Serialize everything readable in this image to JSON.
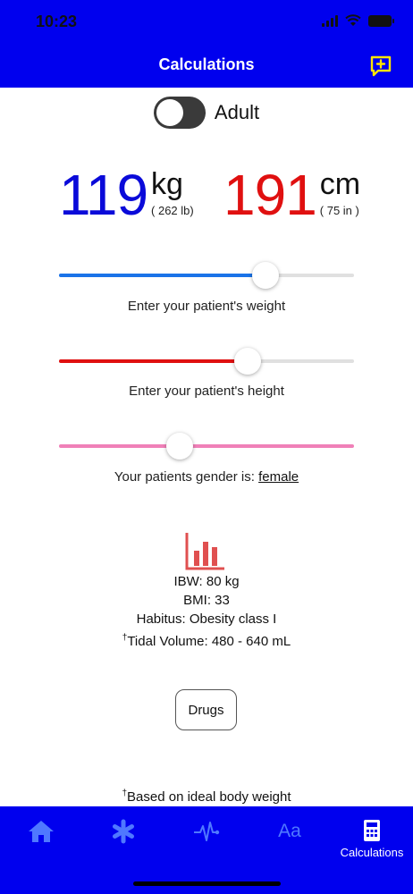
{
  "status_bar": {
    "time": "10:23"
  },
  "nav": {
    "title": "Calculations",
    "feedback_icon": "message-plus-icon"
  },
  "mode_toggle": {
    "label": "Adult",
    "on": false
  },
  "weight": {
    "value": "119",
    "unit": "kg",
    "imperial": "( 262 lb)",
    "slider_fraction": 0.7,
    "caption": "Enter your patient's weight",
    "color": "#0a0ad9",
    "fill_color": "#1a73e8"
  },
  "height": {
    "value": "191",
    "unit": "cm",
    "imperial": "( 75 in )",
    "slider_fraction": 0.64,
    "caption": "Enter your patient's height",
    "color": "#e01010",
    "fill_color": "#e01010"
  },
  "gender": {
    "caption_prefix": "Your patients gender is: ",
    "value": "female",
    "slider_fraction": 0.41,
    "color": "#f080b8"
  },
  "results": {
    "icon": "bar-chart-icon",
    "ibw": "IBW: 80 kg",
    "bmi": "BMI: 33",
    "habitus": "Habitus: Obesity class I",
    "tidal_marker": "†",
    "tidal_volume": "Tidal Volume: 480 - 640 mL"
  },
  "drugs_button": {
    "label": "Drugs"
  },
  "footnote": {
    "marker": "†",
    "text": "Based on ideal body weight"
  },
  "tabbar": {
    "tabs": [
      {
        "icon": "home-icon",
        "label": ""
      },
      {
        "icon": "asterisk-icon",
        "label": ""
      },
      {
        "icon": "pulse-icon",
        "label": ""
      },
      {
        "icon": "text-size-icon",
        "label": "Aa"
      },
      {
        "icon": "calculator-icon",
        "label": "Calculations",
        "active": true
      }
    ]
  },
  "colors": {
    "brand_blue": "#0000ee",
    "accent_red": "#e05050"
  }
}
